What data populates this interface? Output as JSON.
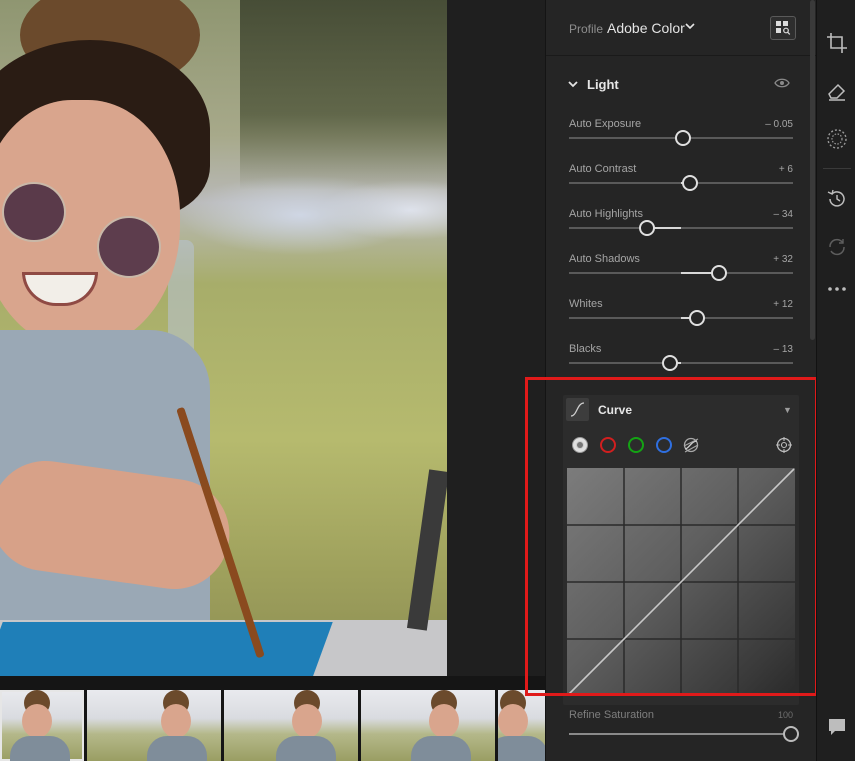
{
  "profile": {
    "label": "Profile",
    "value": "Adobe Color"
  },
  "light_section": {
    "title": "Light"
  },
  "sliders": [
    {
      "label": "Auto Exposure",
      "value": "– 0.05",
      "position": 0.51
    },
    {
      "label": "Auto Contrast",
      "value": "+ 6",
      "position": 0.54
    },
    {
      "label": "Auto Highlights",
      "value": "– 34",
      "position": 0.35
    },
    {
      "label": "Auto Shadows",
      "value": "+ 32",
      "position": 0.67
    },
    {
      "label": "Whites",
      "value": "+ 12",
      "position": 0.57
    },
    {
      "label": "Blacks",
      "value": "– 13",
      "position": 0.45
    }
  ],
  "curve": {
    "title": "Curve"
  },
  "refine_saturation": {
    "label": "Refine Saturation",
    "value": "100"
  },
  "colors": {
    "highlight": "#e01a1a",
    "red_channel": "#d11f1f",
    "green_channel": "#14a414",
    "blue_channel": "#2f6fe0"
  },
  "icons": {
    "toolstrip": [
      "crop-icon",
      "healing-eraser-icon",
      "masking-icon",
      "history-icon",
      "sync-icon",
      "more-icon",
      "comment-icon"
    ],
    "curve": [
      "curve-icon",
      "target-adjust-icon",
      "parametric-curve-icon"
    ]
  }
}
